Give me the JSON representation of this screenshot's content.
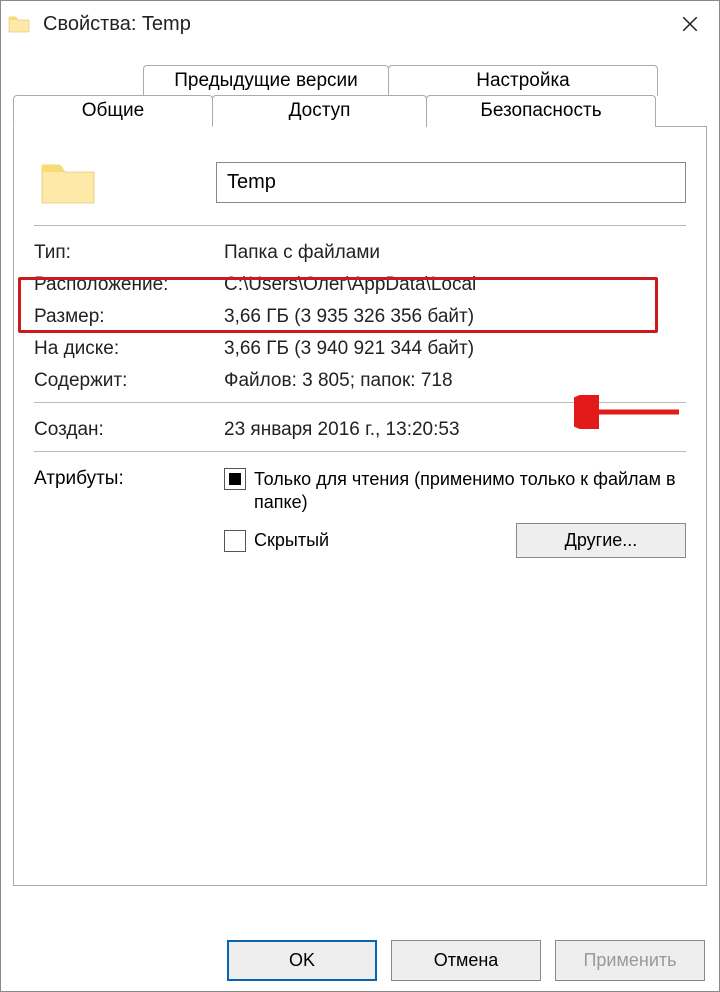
{
  "window": {
    "title": "Свойства: Temp"
  },
  "tabs": {
    "prev_versions": "Предыдущие версии",
    "customize": "Настройка",
    "general": "Общие",
    "sharing": "Доступ",
    "security": "Безопасность"
  },
  "general": {
    "folder_name": "Temp",
    "type_label": "Тип:",
    "type_value": "Папка с файлами",
    "location_label": "Расположение:",
    "location_value": "C:\\Users\\Олег\\AppData\\Local",
    "size_label": "Размер:",
    "size_value": "3,66 ГБ (3 935 326 356 байт)",
    "ondisk_label": "На диске:",
    "ondisk_value": "3,66 ГБ (3 940 921 344 байт)",
    "contains_label": "Содержит:",
    "contains_value": "Файлов: 3 805; папок: 718",
    "created_label": "Создан:",
    "created_value": "23 января 2016 г., 13:20:53",
    "attributes_label": "Атрибуты:",
    "readonly_label": "Только для чтения (применимо только к файлам в папке)",
    "hidden_label": "Скрытый",
    "other_button": "Другие..."
  },
  "buttons": {
    "ok": "OK",
    "cancel": "Отмена",
    "apply": "Применить"
  }
}
